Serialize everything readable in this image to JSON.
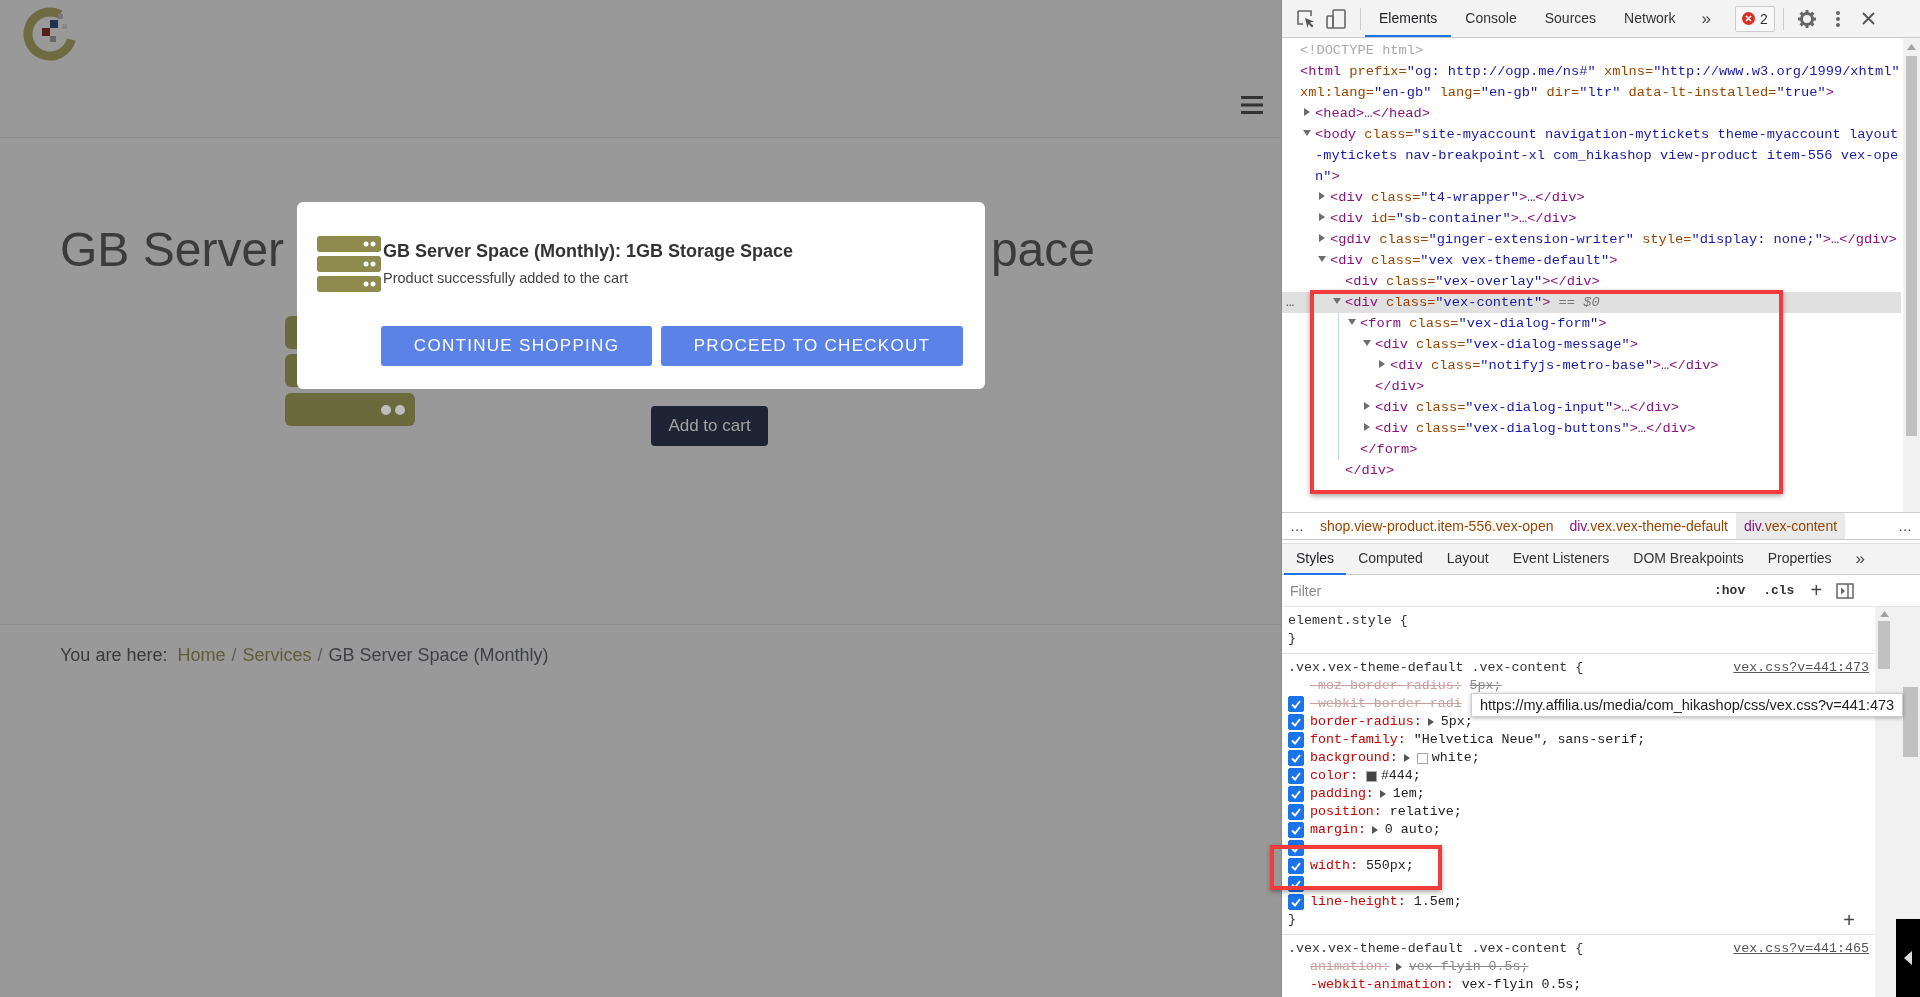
{
  "page": {
    "title_left": "GB Server",
    "title_right": "pace",
    "add_to_cart": "Add to cart",
    "breadcrumb": {
      "label": "You are here:",
      "items": [
        {
          "kind": "link",
          "text": "Home",
          "separator": "/"
        },
        {
          "kind": "link",
          "text": "Services",
          "separator": "/"
        },
        {
          "kind": "current",
          "text": "GB Server Space (Monthly)"
        }
      ]
    }
  },
  "dialog": {
    "title": "GB Server Space (Monthly): 1GB Storage Space",
    "message": "Product successfully added to the cart",
    "buttons": [
      "CONTINUE SHOPPING",
      "PROCEED TO CHECKOUT"
    ]
  },
  "devtools": {
    "tabs": [
      {
        "label": "Elements",
        "selected": true
      },
      {
        "label": "Console",
        "selected": false
      },
      {
        "label": "Sources",
        "selected": false
      },
      {
        "label": "Network",
        "selected": false
      }
    ],
    "more_tabs": "»",
    "error_count": "2",
    "dom_tree": [
      {
        "selected": false,
        "parts": [
          {
            "kind": "doctype",
            "text": "<!DOCTYPE html>"
          }
        ]
      },
      {
        "selected": false,
        "parts": [
          {
            "kind": "tag",
            "text": "<html"
          },
          {
            "kind": "attr",
            "text": " prefix="
          },
          {
            "kind": "value",
            "text": "\"og: http://ogp.me/ns#\""
          },
          {
            "kind": "attr",
            "text": " xmlns="
          },
          {
            "kind": "value",
            "text": "\"http://www.w3.org/1999/xhtml\""
          },
          {
            "kind": "attr",
            "text": " xml:lang="
          },
          {
            "kind": "value",
            "text": "\"en-gb\""
          },
          {
            "kind": "attr",
            "text": " lang="
          },
          {
            "kind": "value",
            "text": "\"en-gb\""
          },
          {
            "kind": "attr",
            "text": " dir="
          },
          {
            "kind": "value",
            "text": "\"ltr\""
          },
          {
            "kind": "attr",
            "text": " data-lt-installed="
          },
          {
            "kind": "value",
            "text": "\"true\""
          },
          {
            "kind": "tag",
            "text": ">"
          }
        ],
        "children": [
          {
            "selected": false,
            "expanded": false,
            "parts": [
              {
                "kind": "tag",
                "text": "<head>…</head>"
              }
            ]
          },
          {
            "selected": false,
            "expanded": true,
            "parts": [
              {
                "kind": "tag",
                "text": "<body"
              },
              {
                "kind": "attr",
                "text": " class="
              },
              {
                "kind": "value",
                "text": "\"site-myaccount navigation-mytickets theme-myaccount layout-mytickets nav-breakpoint-xl com_hikashop view-product item-556 vex-open\""
              },
              {
                "kind": "tag",
                "text": ">"
              }
            ],
            "children": [
              {
                "selected": false,
                "expanded": false,
                "parts": [
                  {
                    "kind": "tag",
                    "text": "<div"
                  },
                  {
                    "kind": "attr",
                    "text": " class="
                  },
                  {
                    "kind": "value",
                    "text": "\"t4-wrapper\""
                  },
                  {
                    "kind": "tag",
                    "text": ">…</div>"
                  }
                ]
              },
              {
                "selected": false,
                "expanded": false,
                "parts": [
                  {
                    "kind": "tag",
                    "text": "<div"
                  },
                  {
                    "kind": "attr",
                    "text": " id="
                  },
                  {
                    "kind": "value",
                    "text": "\"sb-container\""
                  },
                  {
                    "kind": "tag",
                    "text": ">…</div>"
                  }
                ]
              },
              {
                "selected": false,
                "expanded": false,
                "parts": [
                  {
                    "kind": "tag",
                    "text": "<gdiv"
                  },
                  {
                    "kind": "attr",
                    "text": " class="
                  },
                  {
                    "kind": "value",
                    "text": "\"ginger-extension-writer\""
                  },
                  {
                    "kind": "attr",
                    "text": " style="
                  },
                  {
                    "kind": "value",
                    "text": "\"display: none;\""
                  },
                  {
                    "kind": "tag",
                    "text": ">…</gdiv>"
                  }
                ]
              },
              {
                "selected": false,
                "expanded": true,
                "parts": [
                  {
                    "kind": "tag",
                    "text": "<div"
                  },
                  {
                    "kind": "attr",
                    "text": " class="
                  },
                  {
                    "kind": "value",
                    "text": "\"vex vex-theme-default\""
                  },
                  {
                    "kind": "tag",
                    "text": ">"
                  }
                ],
                "children": [
                  {
                    "selected": false,
                    "parts": [
                      {
                        "kind": "tag",
                        "text": "<div"
                      },
                      {
                        "kind": "attr",
                        "text": " class="
                      },
                      {
                        "kind": "value",
                        "text": "\"vex-overlay\""
                      },
                      {
                        "kind": "tag",
                        "text": "></div>"
                      }
                    ]
                  },
                  {
                    "selected": true,
                    "expanded": true,
                    "marker": "…",
                    "parts": [
                      {
                        "kind": "tag",
                        "text": "<div"
                      },
                      {
                        "kind": "attr",
                        "text": " class="
                      },
                      {
                        "kind": "value",
                        "text": "\"vex-content\""
                      },
                      {
                        "kind": "tag",
                        "text": ">"
                      },
                      {
                        "kind": "ref",
                        "text": " == $0"
                      }
                    ],
                    "children": [
                      {
                        "selected": false,
                        "expanded": true,
                        "parts": [
                          {
                            "kind": "tag",
                            "text": "<form"
                          },
                          {
                            "kind": "attr",
                            "text": " class="
                          },
                          {
                            "kind": "value",
                            "text": "\"vex-dialog-form\""
                          },
                          {
                            "kind": "tag",
                            "text": ">"
                          }
                        ],
                        "children": [
                          {
                            "selected": false,
                            "expanded": true,
                            "parts": [
                              {
                                "kind": "tag",
                                "text": "<div"
                              },
                              {
                                "kind": "attr",
                                "text": " class="
                              },
                              {
                                "kind": "value",
                                "text": "\"vex-dialog-message\""
                              },
                              {
                                "kind": "tag",
                                "text": ">"
                              }
                            ],
                            "children": [
                              {
                                "selected": false,
                                "expanded": false,
                                "parts": [
                                  {
                                    "kind": "tag",
                                    "text": "<div"
                                  },
                                  {
                                    "kind": "attr",
                                    "text": " class="
                                  },
                                  {
                                    "kind": "value",
                                    "text": "\"notifyjs-metro-base\""
                                  },
                                  {
                                    "kind": "tag",
                                    "text": ">…</div>"
                                  }
                                ]
                              }
                            ],
                            "close": "</div>"
                          },
                          {
                            "selected": false,
                            "expanded": false,
                            "parts": [
                              {
                                "kind": "tag",
                                "text": "<div"
                              },
                              {
                                "kind": "attr",
                                "text": " class="
                              },
                              {
                                "kind": "value",
                                "text": "\"vex-dialog-input\""
                              },
                              {
                                "kind": "tag",
                                "text": ">…</div>"
                              }
                            ]
                          },
                          {
                            "selected": false,
                            "expanded": false,
                            "parts": [
                              {
                                "kind": "tag",
                                "text": "<div"
                              },
                              {
                                "kind": "attr",
                                "text": " class="
                              },
                              {
                                "kind": "value",
                                "text": "\"vex-dialog-buttons\""
                              },
                              {
                                "kind": "tag",
                                "text": ">…</div>"
                              }
                            ]
                          }
                        ],
                        "close": "</form>"
                      }
                    ],
                    "close": "</div>"
                  }
                ]
              }
            ]
          }
        ]
      }
    ],
    "breadcrumbs": {
      "more_left": "…",
      "more_right": "…",
      "items": [
        {
          "classes": "shop.view-product.item-556.vex-open",
          "selected": false
        },
        {
          "tag": "div",
          "classes": ".vex.vex-theme-default",
          "selected": false
        },
        {
          "tag": "div",
          "classes": ".vex-content",
          "selected": true
        }
      ]
    },
    "styles_tabs": [
      {
        "label": "Styles",
        "selected": true
      },
      {
        "label": "Computed",
        "selected": false
      },
      {
        "label": "Layout",
        "selected": false
      },
      {
        "label": "Event Listeners",
        "selected": false
      },
      {
        "label": "DOM Breakpoints",
        "selected": false
      },
      {
        "label": "Properties",
        "selected": false
      }
    ],
    "styles_more": "»",
    "filter": {
      "placeholder": "Filter"
    },
    "hov": ":hov",
    "cls": ".cls",
    "new_rule": "+",
    "rules": [
      {
        "selector": "element.style {",
        "close": "}"
      },
      {
        "selector": ".vex.vex-theme-default .vex-content {",
        "source": "vex.css?v=441:473",
        "close": "}",
        "add": "+",
        "props": [
          {
            "kind": "bare",
            "name": "-moz-border-radius:",
            "value": "5px;",
            "struck": true
          },
          {
            "kind": "toggle",
            "checked": true,
            "name": "-webkit-border-radi",
            "struck": true
          },
          {
            "kind": "toggle",
            "checked": true,
            "name": "border-radius:",
            "value": "5px;",
            "struck": false,
            "expandable": true
          },
          {
            "kind": "toggle",
            "checked": true,
            "name": "font-family:",
            "value": "\"Helvetica Neue\", sans-serif;",
            "struck": false
          },
          {
            "kind": "toggle",
            "checked": true,
            "name": "background:",
            "value": "white;",
            "struck": false,
            "expandable": true,
            "color": "#ffffff"
          },
          {
            "kind": "toggle",
            "checked": true,
            "name": "color:",
            "value": "#444;",
            "struck": false,
            "color": "#444444"
          },
          {
            "kind": "toggle",
            "checked": true,
            "name": "padding:",
            "value": "1em;",
            "struck": false,
            "expandable": true
          },
          {
            "kind": "toggle",
            "checked": true,
            "name": "position:",
            "value": "relative;",
            "struck": false
          },
          {
            "kind": "toggle",
            "checked": true,
            "name": "margin:",
            "value": "0 auto;",
            "struck": false,
            "expandable": true
          },
          {
            "kind": "toggle",
            "checked": true
          },
          {
            "kind": "toggle",
            "checked": true,
            "name": "width:",
            "value": "550px;",
            "struck": false
          },
          {
            "kind": "toggle",
            "checked": true
          },
          {
            "kind": "toggle",
            "checked": true,
            "name": "line-height:",
            "value": "1.5em;",
            "struck": false
          }
        ]
      },
      {
        "selector": ".vex.vex-theme-default .vex-content {",
        "source": "vex.css?v=441:465",
        "props": [
          {
            "kind": "bare",
            "name": "animation:",
            "value": "vex-flyin 0.5s;",
            "struck": true,
            "expandable": true
          },
          {
            "kind": "bare",
            "name": "-webkit-animation:",
            "value": "vex-flyin 0.5s;",
            "struck": false
          }
        ]
      }
    ],
    "tooltip": "https://my.affilia.us/media/com_hikashop/css/vex.css?v=441:473"
  }
}
